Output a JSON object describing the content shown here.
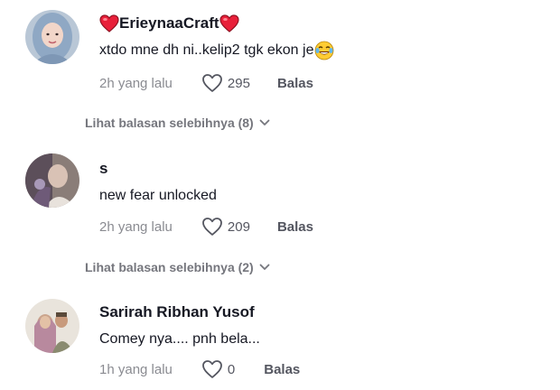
{
  "comments": [
    {
      "username": "ErieynaaCraft",
      "text": "xtdo mne dh ni..kelip2 tgk ekon je",
      "time": "2h yang lalu",
      "likes": "295",
      "reply_label": "Balas",
      "username_decor_icon": "red-heart-icon",
      "text_emoji_icon": "tears-of-joy-emoji-icon",
      "more_replies": "Lihat balasan selebihnya (8)"
    },
    {
      "username": "s",
      "text": "new fear unlocked",
      "time": "2h yang lalu",
      "likes": "209",
      "reply_label": "Balas",
      "more_replies": "Lihat balasan selebihnya (2)"
    },
    {
      "username": "Sarirah Ribhan Yusof",
      "text": "Comey nya.... pnh bela...",
      "time": "1h yang lalu",
      "likes": "0",
      "reply_label": "Balas"
    }
  ],
  "colors": {
    "username": "#161823",
    "meta_text": "#8a8b91",
    "action_text": "#545660",
    "heart_emoji": "#e8203a"
  }
}
